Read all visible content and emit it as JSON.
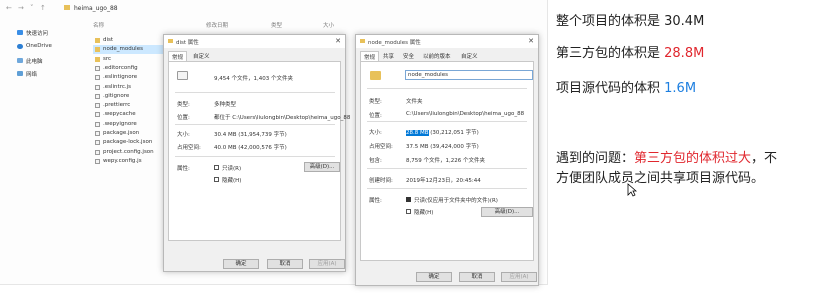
{
  "explorer": {
    "path": "heima_ugo_88",
    "columns": [
      "名称",
      "修改日期",
      "类型",
      "大小"
    ],
    "nav_items": [
      {
        "label": "快速访问",
        "icon": "star-icon"
      },
      {
        "label": "OneDrive",
        "icon": "cloud-icon"
      },
      {
        "label": "此电脑",
        "icon": "computer-icon"
      },
      {
        "label": "网络",
        "icon": "network-icon"
      }
    ],
    "files": [
      {
        "name": "dist",
        "type": "folder"
      },
      {
        "name": "node_modules",
        "type": "folder"
      },
      {
        "name": "src",
        "type": "folder"
      },
      {
        "name": ".editorconfig",
        "type": "file"
      },
      {
        "name": ".eslintignore",
        "type": "file"
      },
      {
        "name": ".eslintrc.js",
        "type": "file"
      },
      {
        "name": ".gitignore",
        "type": "file"
      },
      {
        "name": ".prettierrc",
        "type": "file"
      },
      {
        "name": ".wepycache",
        "type": "file"
      },
      {
        "name": ".wepyignore",
        "type": "file"
      },
      {
        "name": "package.json",
        "type": "file"
      },
      {
        "name": "package-lock.json",
        "type": "file"
      },
      {
        "name": "project.config.json",
        "type": "file"
      },
      {
        "name": "wepy.config.js",
        "type": "file"
      }
    ]
  },
  "dist_dialog": {
    "title": "dist 属性",
    "tabs": [
      "常规",
      "自定义"
    ],
    "summary": "9,454 个文件，1,403 个文件夹",
    "type_label": "类型:",
    "type_value": "多种类型",
    "location_label": "位置:",
    "location_value": "都位于 C:\\Users\\liulongbin\\Desktop\\heima_ugo_88",
    "size_label": "大小:",
    "size_value": "30.4 MB (31,954,739 字节)",
    "disk_label": "占用空间:",
    "disk_value": "40.0 MB (42,000,576 字节)",
    "attr_label": "属性:",
    "readonly_label": "只读(R)",
    "hidden_label": "隐藏(H)",
    "advanced_button": "高级(D)...",
    "ok_button": "确定",
    "cancel_button": "取消",
    "apply_button": "应用(A)"
  },
  "nm_dialog": {
    "title": "node_modules 属性",
    "tabs": [
      "常规",
      "共享",
      "安全",
      "以前的版本",
      "自定义"
    ],
    "name_value": "node_modules",
    "type_label": "类型:",
    "type_value": "文件夹",
    "location_label": "位置:",
    "location_value": "C:\\Users\\liulongbin\\Desktop\\heima_ugo_88",
    "size_label": "大小:",
    "size_highlight": "28.8 MB",
    "size_rest": " (30,212,051 字节)",
    "disk_label": "占用空间:",
    "disk_value": "37.5 MB (39,424,000 字节)",
    "contains_label": "包含:",
    "contains_value": "8,759 个文件，1,226 个文件夹",
    "created_label": "创建时间:",
    "created_value": "2019年12月23日，20:45:44",
    "attr_label": "属性:",
    "readonly_label": "只读(仅应用于文件夹中的文件)(R)",
    "hidden_label": "隐藏(H)",
    "advanced_button": "高级(D)...",
    "ok_button": "确定",
    "cancel_button": "取消",
    "apply_button": "应用(A)"
  },
  "notes": {
    "line1": "整个项目的体积是 30.4M",
    "line2_prefix": "第三方包的体积是 ",
    "line2_value": "28.8M",
    "line3_prefix": "项目源代码的体积 ",
    "line3_value": "1.6M",
    "line4_prefix": "遇到的问题：",
    "line4_red": "第三方包的体积过大",
    "line4_suffix": "，不",
    "line5": "方便团队成员之间共享项目源代码。",
    "red_color": "#e0272e",
    "blue_color": "#1d7fe0"
  }
}
